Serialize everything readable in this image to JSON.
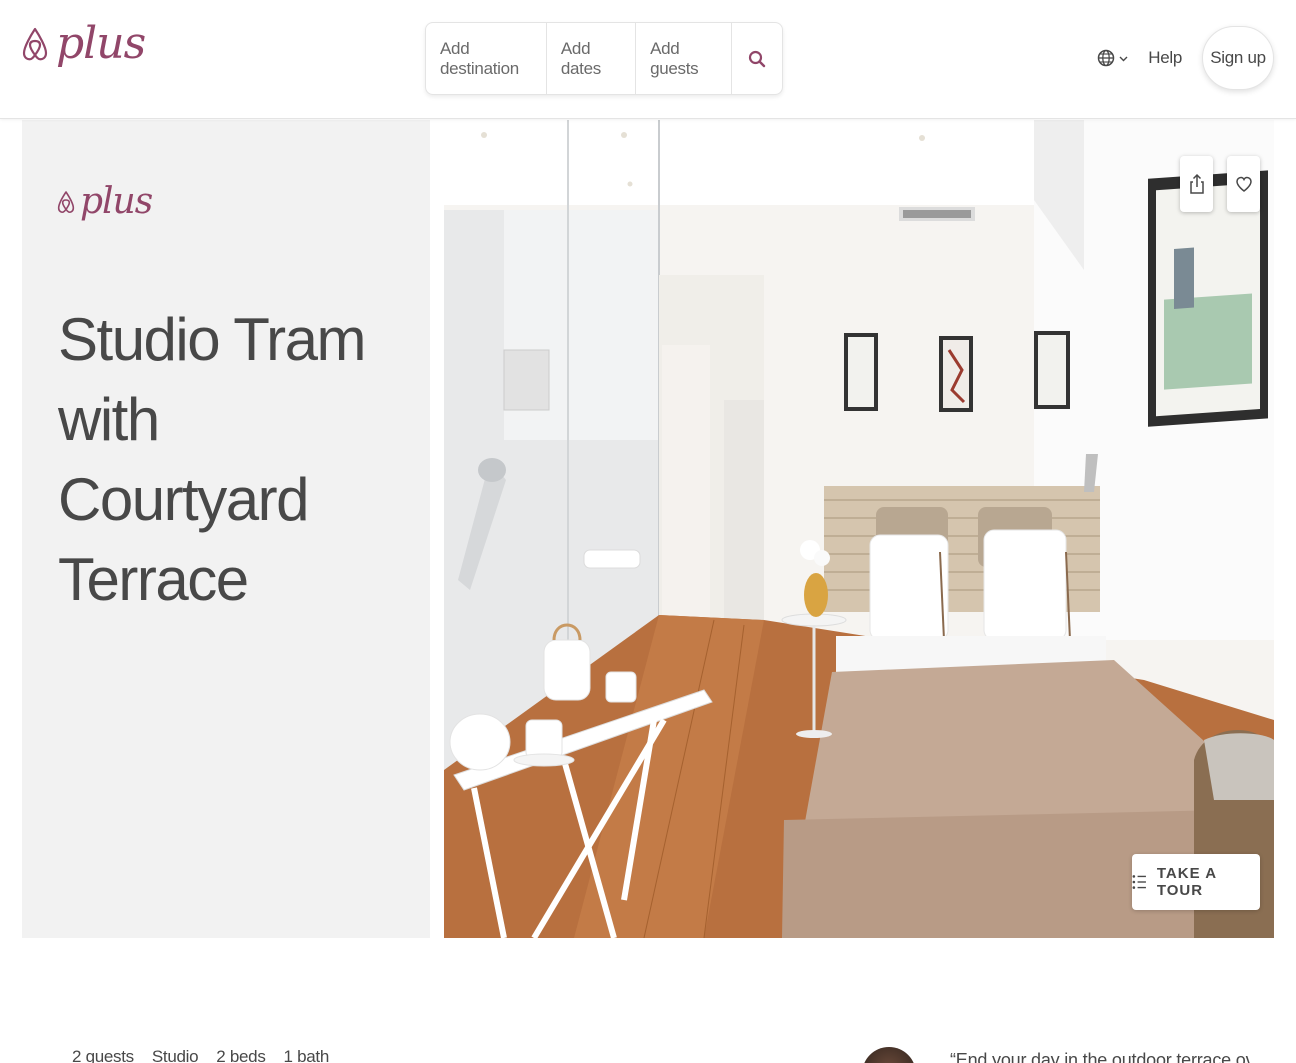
{
  "header": {
    "logo_text": "plus",
    "search": {
      "destination": "Add destination",
      "dates": "Add dates",
      "guests": "Add guests"
    },
    "help_label": "Help",
    "signup_label": "Sign up"
  },
  "hero": {
    "logo_text": "plus",
    "title": "Studio Tram with Courtyard Terrace",
    "tour_label": "TAKE A TOUR"
  },
  "stats": [
    "2 guests",
    "Studio",
    "2 beds",
    "1 bath"
  ],
  "quote": "“End your day in the outdoor terrace over",
  "colors": {
    "brand": "#914669",
    "text": "#484848",
    "panel": "#f2f2f2"
  },
  "icons": {
    "search": "search-icon",
    "language": "globe-icon",
    "share": "share-icon",
    "save": "heart-icon",
    "tour": "list-icon"
  }
}
